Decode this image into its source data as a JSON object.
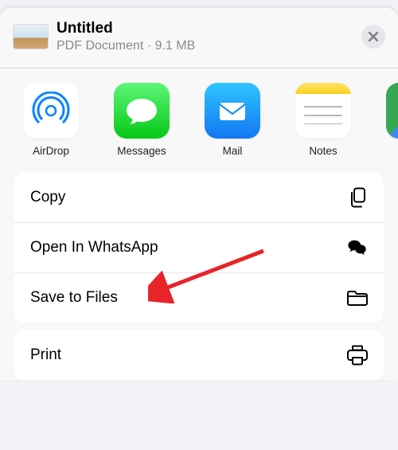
{
  "header": {
    "title": "Untitled",
    "subtitle": "PDF Document · 9.1 MB"
  },
  "apps": [
    {
      "label": "AirDrop"
    },
    {
      "label": "Messages"
    },
    {
      "label": "Mail"
    },
    {
      "label": "Notes"
    }
  ],
  "actions": {
    "group1": [
      {
        "label": "Copy"
      },
      {
        "label": "Open In WhatsApp"
      },
      {
        "label": "Save to Files"
      }
    ],
    "group2": [
      {
        "label": "Print"
      }
    ]
  }
}
